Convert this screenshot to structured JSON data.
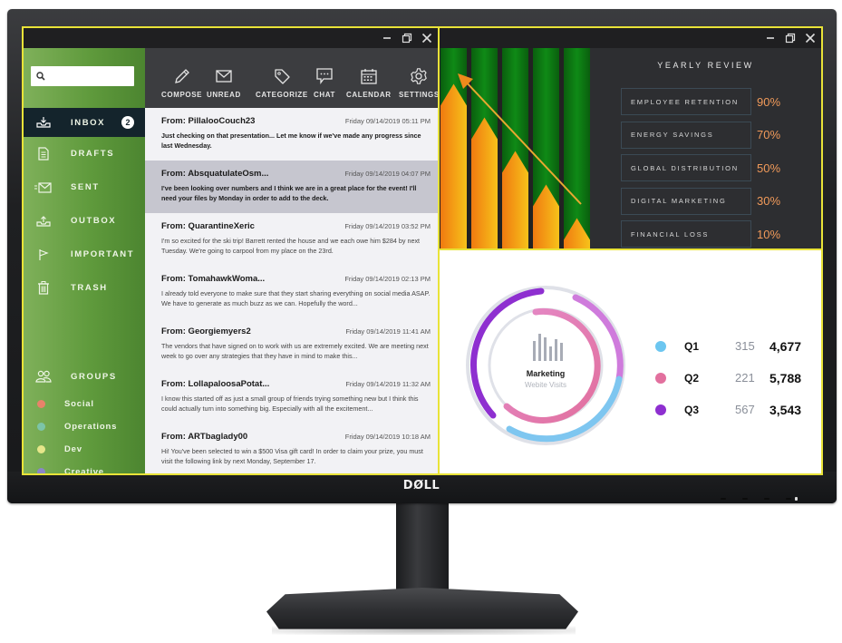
{
  "monitor": {
    "brand": "DØLL"
  },
  "mail_window": {
    "window_controls": [
      "minimize",
      "restore",
      "close"
    ],
    "search": {
      "placeholder": "",
      "value": ""
    },
    "toolbar": [
      {
        "id": "compose",
        "label": "COMPOSE",
        "icon": "pencil-icon"
      },
      {
        "id": "unread",
        "label": "UNREAD",
        "icon": "envelope-icon"
      },
      {
        "id": "categorize",
        "label": "CATEGORIZE",
        "icon": "tag-icon"
      },
      {
        "id": "chat",
        "label": "CHAT",
        "icon": "chat-bubble-icon"
      },
      {
        "id": "calendar",
        "label": "CALENDAR",
        "icon": "calendar-icon"
      },
      {
        "id": "settings",
        "label": "SETTINGS",
        "icon": "gear-icon"
      }
    ],
    "nav": [
      {
        "label": "INBOX",
        "icon": "inbox-icon",
        "badge": "2",
        "active": true
      },
      {
        "label": "DRAFTS",
        "icon": "document-icon"
      },
      {
        "label": "SENT",
        "icon": "sent-mail-icon"
      },
      {
        "label": "OUTBOX",
        "icon": "outbox-icon"
      },
      {
        "label": "IMPORTANT",
        "icon": "flag-icon"
      },
      {
        "label": "TRASH",
        "icon": "trash-icon"
      }
    ],
    "groups_label": "GROUPS",
    "groups": [
      {
        "label": "Social",
        "color": "#e8826a"
      },
      {
        "label": "Operations",
        "color": "#7cc4a8"
      },
      {
        "label": "Dev",
        "color": "#e6e68a"
      },
      {
        "label": "Creative",
        "color": "#8a86c8"
      }
    ],
    "messages": [
      {
        "from": "From: PillalooCouch23",
        "date": "Friday 09/14/2019 05:11 PM",
        "preview": "Just checking on that presentation... Let me know if we've made any progress since last Wednesday.",
        "unread": true,
        "selected": false
      },
      {
        "from": "From: AbsquatulateOsm...",
        "date": "Friday 09/14/2019 04:07 PM",
        "preview": "I've been looking over numbers and I think we are in a great place for the event! I'll need your files by Monday in order to add to the deck.",
        "unread": true,
        "selected": true
      },
      {
        "from": "From: QuarantineXeric",
        "date": "Friday 09/14/2019 03:52 PM",
        "preview": "I'm so excited for the ski trip! Barrett rented the house and we each owe him $284 by next Tuesday. We're going to carpool from my place on the 23rd.",
        "unread": false,
        "selected": false
      },
      {
        "from": "From: TomahawkWoma...",
        "date": "Friday 09/14/2019 02:13 PM",
        "preview": "I already told everyone to make sure that they start sharing everything on social media ASAP. We have to generate as much buzz as we can. Hopefully the word...",
        "unread": false,
        "selected": false
      },
      {
        "from": "From: Georgiemyers2",
        "date": "Friday 09/14/2019 11:41 AM",
        "preview": "The vendors that have signed on to work with us are extremely excited. We are meeting next week to go over any strategies that they have in mind to make this...",
        "unread": false,
        "selected": false
      },
      {
        "from": "From: LollapaloosaPotat...",
        "date": "Friday 09/14/2019 11:32 AM",
        "preview": "I know this started off as just a small group of friends trying something new but I think this could actually turn into something big. Especially with all the excitement...",
        "unread": false,
        "selected": false
      },
      {
        "from": "From: ARTbaglady00",
        "date": "Friday 09/14/2019 10:18 AM",
        "preview": "Hi! You've been selected to win a $500 Visa gift card! In order to claim your prize, you must visit the following link by next Monday, September 17.",
        "unread": false,
        "selected": false
      }
    ]
  },
  "review_window": {
    "window_controls": [
      "minimize",
      "restore",
      "close"
    ],
    "title": "YEARLY REVIEW",
    "colors": {
      "bar_background": "#0d7a12",
      "bar_fill": "#f59a12",
      "value_text": "#f19a5a"
    },
    "bar_levels": [
      0.9,
      0.7,
      0.5,
      0.3,
      0.1
    ],
    "rows": [
      {
        "label": "EMPLOYEE RETENTION",
        "value": "90%"
      },
      {
        "label": "ENERGY SAVINGS",
        "value": "70%"
      },
      {
        "label": "GLOBAL DISTRIBUTION",
        "value": "50%"
      },
      {
        "label": "DIGITAL MARKETING",
        "value": "30%"
      },
      {
        "label": "FINANCIAL LOSS",
        "value": "10%"
      }
    ]
  },
  "marketing_window": {
    "title": "Marketing",
    "subtitle": "Webite Visits",
    "legend": [
      {
        "label": "Q1",
        "small": "315",
        "big": "4,677",
        "color": "#6cc6f0"
      },
      {
        "label": "Q2",
        "small": "221",
        "big": "5,788",
        "color": "#e2709e"
      },
      {
        "label": "Q3",
        "small": "567",
        "big": "3,543",
        "color": "#8e2fd0"
      }
    ]
  }
}
